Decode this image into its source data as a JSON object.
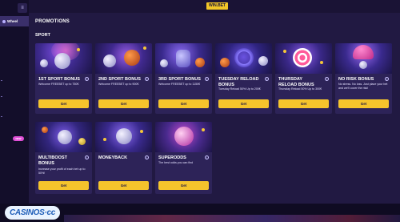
{
  "sidebar": {
    "menu_icon": "menu-icon",
    "wheel_label": "Wheel",
    "pill_label": "NEW"
  },
  "header": {
    "logo_text": "WIN.BET"
  },
  "page": {
    "title": "PROMOTIONS",
    "section": "SPORT"
  },
  "cards": [
    {
      "title": "1ST SPORT BONUS",
      "desc": "Welcome FREEBET up to 750€",
      "button": "Get"
    },
    {
      "title": "2ND SPORT BONUS",
      "desc": "Welcome FREEBET up to 900€",
      "button": "Get"
    },
    {
      "title": "3RD SPORT BONUS",
      "desc": "Welcome FREEBET up to 1150€",
      "button": "Get"
    },
    {
      "title": "TUESDAY RELOAD BONUS",
      "desc": "Tuesday Reload 50% Up to 200€",
      "button": "Get"
    },
    {
      "title": "THURSDAY RELOAD BONUS",
      "desc": "Thursday Reload 50% Up to 300€",
      "button": "Get"
    },
    {
      "title": "NO RISK BONUS",
      "desc": "No stress. No loss. Just place your bet and we'll cover the risk!",
      "button": "Get"
    },
    {
      "title": "MULTIBOOST BONUS",
      "desc": "Increase your profit of each bet up to 50%!",
      "button": "Get"
    },
    {
      "title": "MONEYBACK",
      "desc": "",
      "button": "Get"
    },
    {
      "title": "SUPERODDS",
      "desc": "The best odds you can find",
      "button": "Get"
    }
  ],
  "watermark": {
    "text": "CASINOS·cc"
  },
  "colors": {
    "accent": "#f5c42c",
    "background": "#211942",
    "card": "#2d2358"
  }
}
